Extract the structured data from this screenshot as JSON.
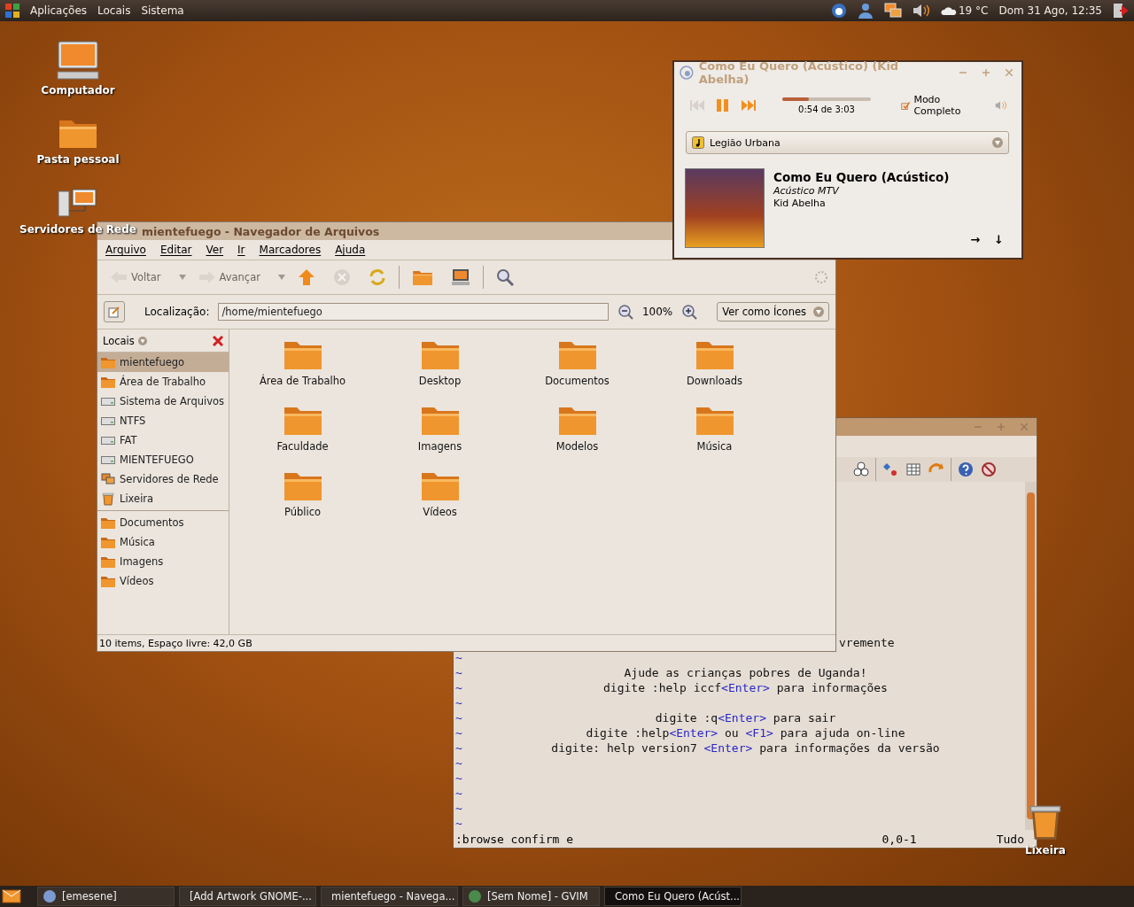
{
  "top_panel": {
    "menus": [
      "Aplicações",
      "Locais",
      "Sistema"
    ],
    "weather": "19 °C",
    "clock": "Dom 31 Ago, 12:35"
  },
  "desktop_icons": [
    {
      "label": "Computador",
      "kind": "computer"
    },
    {
      "label": "Pasta pessoal",
      "kind": "home"
    },
    {
      "label": "Servidores de Rede",
      "kind": "network"
    },
    {
      "label": "Lixeira",
      "kind": "trash"
    }
  ],
  "gvim": {
    "lines": [
      {
        "parts": [
          {
            "text": "vremente",
            "kind": "tail"
          }
        ]
      },
      {
        "marker": "~"
      },
      {
        "marker": "~",
        "parts": [
          {
            "text": "Ajude as crianças pobres de Uganda!",
            "kind": "plain"
          }
        ]
      },
      {
        "marker": "~",
        "parts": [
          {
            "text": "digite :help iccf",
            "kind": "plain"
          },
          {
            "text": "<Enter>",
            "kind": "key"
          },
          {
            "text": " para informações",
            "kind": "plain"
          }
        ]
      },
      {
        "marker": "~"
      },
      {
        "marker": "~",
        "parts": [
          {
            "text": "digite :q",
            "kind": "plain"
          },
          {
            "text": "<Enter>",
            "kind": "key"
          },
          {
            "text": " para sair",
            "kind": "plain"
          }
        ]
      },
      {
        "marker": "~",
        "parts": [
          {
            "text": "digite :help",
            "kind": "plain"
          },
          {
            "text": "<Enter>",
            "kind": "key"
          },
          {
            "text": " ou ",
            "kind": "plain"
          },
          {
            "text": "<F1>",
            "kind": "key"
          },
          {
            "text": " para ajuda on-line",
            "kind": "plain"
          }
        ]
      },
      {
        "marker": "~",
        "parts": [
          {
            "text": "digite: help version7 ",
            "kind": "plain"
          },
          {
            "text": "<Enter>",
            "kind": "key"
          },
          {
            "text": " para informações da versão",
            "kind": "plain"
          }
        ]
      },
      {
        "marker": "~"
      },
      {
        "marker": "~"
      },
      {
        "marker": "~"
      },
      {
        "marker": "~"
      },
      {
        "marker": "~"
      }
    ],
    "command": ":browse confirm e",
    "position": "0,0-1",
    "scroll": "Tudo"
  },
  "file_manager": {
    "title": "mientefuego - Navegador de Arquivos",
    "menus": [
      "Arquivo",
      "Editar",
      "Ver",
      "Ir",
      "Marcadores",
      "Ajuda"
    ],
    "toolbar": [
      {
        "kind": "back",
        "label": "Voltar",
        "disabled": true
      },
      {
        "kind": "forward",
        "label": "Avançar",
        "disabled": true
      },
      {
        "kind": "up",
        "disabled": false
      },
      {
        "kind": "stop",
        "disabled": true
      },
      {
        "kind": "reload",
        "disabled": false
      },
      {
        "kind": "home",
        "disabled": false
      },
      {
        "kind": "computer",
        "disabled": false
      },
      {
        "kind": "search",
        "disabled": false
      }
    ],
    "location_label": "Localização:",
    "location": "/home/mientefuego",
    "zoom": "100%",
    "view_mode": "Ver como Ícones",
    "sidebar_title": "Locais",
    "places": [
      {
        "label": "mientefuego",
        "kind": "folder",
        "selected": true
      },
      {
        "label": "Área de Trabalho",
        "kind": "folder",
        "selected": false
      },
      {
        "label": "Sistema de Arquivos",
        "kind": "drive",
        "selected": false
      },
      {
        "label": "NTFS",
        "kind": "drive",
        "selected": false
      },
      {
        "label": "FAT",
        "kind": "drive",
        "selected": false
      },
      {
        "label": "MIENTEFUEGO",
        "kind": "drive",
        "selected": false
      },
      {
        "label": "Servidores de Rede",
        "kind": "network",
        "selected": false
      },
      {
        "label": "Lixeira",
        "kind": "trash",
        "selected": false
      }
    ],
    "bookmarks": [
      {
        "label": "Documentos",
        "selected": false
      },
      {
        "label": "Música",
        "selected": false
      },
      {
        "label": "Imagens",
        "selected": false
      },
      {
        "label": "Vídeos",
        "selected": false
      }
    ],
    "files": [
      "Área de Trabalho",
      "Desktop",
      "Documentos",
      "Downloads",
      "Faculdade",
      "Imagens",
      "Modelos",
      "Música",
      "Público",
      "Vídeos"
    ],
    "status": "10 items, Espaço livre: 42,0 GB"
  },
  "music_player": {
    "title": "Como Eu Quero (Acústico) (Kid Abelha)",
    "controls": [
      {
        "kind": "previous",
        "disabled": true
      },
      {
        "kind": "pause",
        "disabled": false
      },
      {
        "kind": "next",
        "disabled": false
      }
    ],
    "level": 0.3,
    "time": "0:54 de 3:03",
    "mode": "Modo Completo",
    "playlist": "Legião Urbana",
    "song": "Como Eu Quero (Acústico)",
    "album": "Acústico MTV",
    "artist": "Kid Abelha",
    "arrows": [
      "→",
      "↓"
    ]
  },
  "taskbar": {
    "items": [
      {
        "label": "[emesene]",
        "kind": "messenger",
        "selected": false
      },
      {
        "label": "[Add Artwork GNOME-...",
        "kind": "browser",
        "selected": false
      },
      {
        "label": "mientefuego - Navega...",
        "kind": "files",
        "selected": false
      },
      {
        "label": "[Sem Nome] - GVIM",
        "kind": "vim",
        "selected": false
      },
      {
        "label": "Como Eu Quero (Acúst...",
        "kind": "player",
        "selected": true
      }
    ]
  }
}
